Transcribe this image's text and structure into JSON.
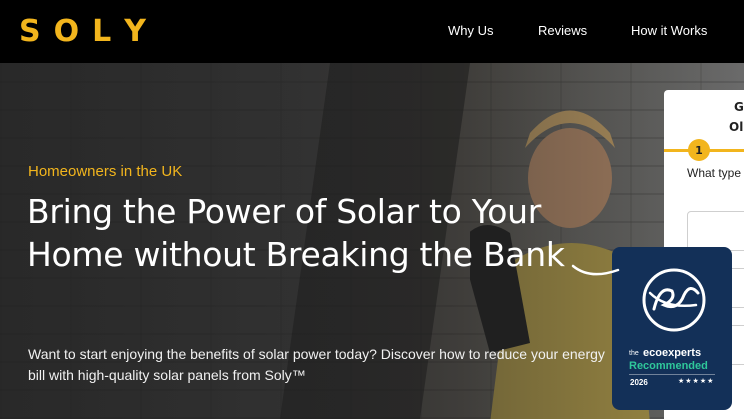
{
  "header": {
    "logo_letters": [
      "S",
      "O",
      "L",
      "Y"
    ],
    "nav": [
      "Why Us",
      "Reviews",
      "How it Works"
    ]
  },
  "hero": {
    "eyebrow": "Homeowners in the UK",
    "headline": "Bring the Power of Solar to Your Home without Breaking the Bank",
    "subcopy": "Want to start enjoying the benefits of solar power today? Discover how to reduce your energy bill with high-quality solar panels from Soly™"
  },
  "form": {
    "title_line1": "G",
    "title_line2": "Ol",
    "step": "1",
    "question": "What type"
  },
  "badge": {
    "the": "the",
    "brand": "ecoexperts",
    "recommended": "Recommended",
    "year": "2026",
    "stars": "★★★★★"
  },
  "colors": {
    "accent": "#f2b51d",
    "badge_bg": "#133058",
    "badge_green": "#2fc79a"
  }
}
